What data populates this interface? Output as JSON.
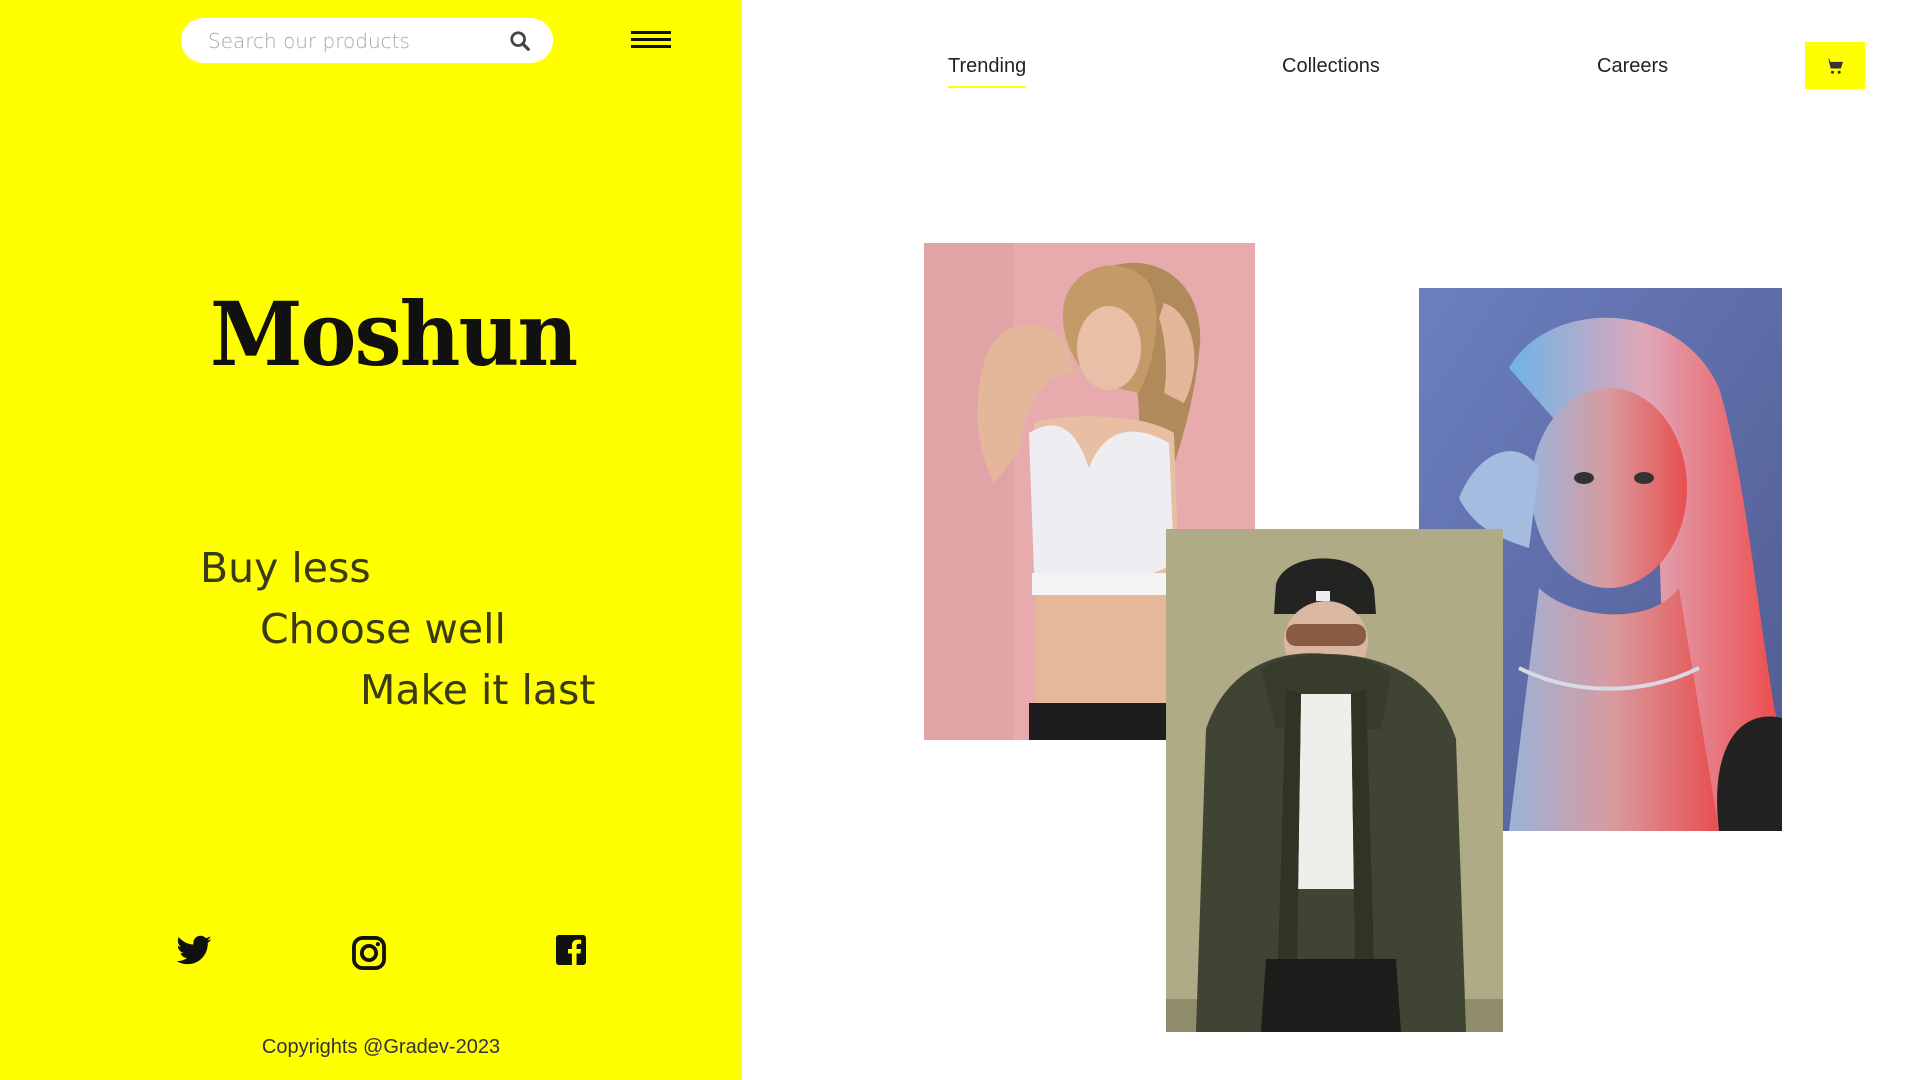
{
  "header": {
    "search": {
      "placeholder": "Search our products",
      "value": ""
    },
    "menu_icon": "hamburger-menu-icon",
    "search_icon": "search-icon"
  },
  "brand": {
    "logo_text": "Moshun"
  },
  "tagline": {
    "line1": "Buy less",
    "line2": "Choose well",
    "line3": "Make it last"
  },
  "social": {
    "items": [
      {
        "name": "Twitter",
        "icon": "twitter-icon"
      },
      {
        "name": "Instagram",
        "icon": "instagram-icon"
      },
      {
        "name": "Facebook",
        "icon": "facebook-icon"
      }
    ]
  },
  "footer": {
    "copyright": "Copyrights @Gradev-2023"
  },
  "nav": {
    "items": [
      {
        "label": "Trending",
        "active": true
      },
      {
        "label": "Collections",
        "active": false
      },
      {
        "label": "Careers",
        "active": false
      }
    ],
    "cart_icon": "cart-icon"
  },
  "gallery": {
    "images": [
      {
        "description": "Woman in white sports bra against pink background"
      },
      {
        "description": "Blonde woman with red and blue lighting"
      },
      {
        "description": "Man in dark parka, beanie and sunglasses against olive wall"
      }
    ]
  },
  "colors": {
    "accent": "#ffff00",
    "text_dark": "#111111",
    "tagline": "#3a3a16",
    "background": "#ffffff"
  }
}
